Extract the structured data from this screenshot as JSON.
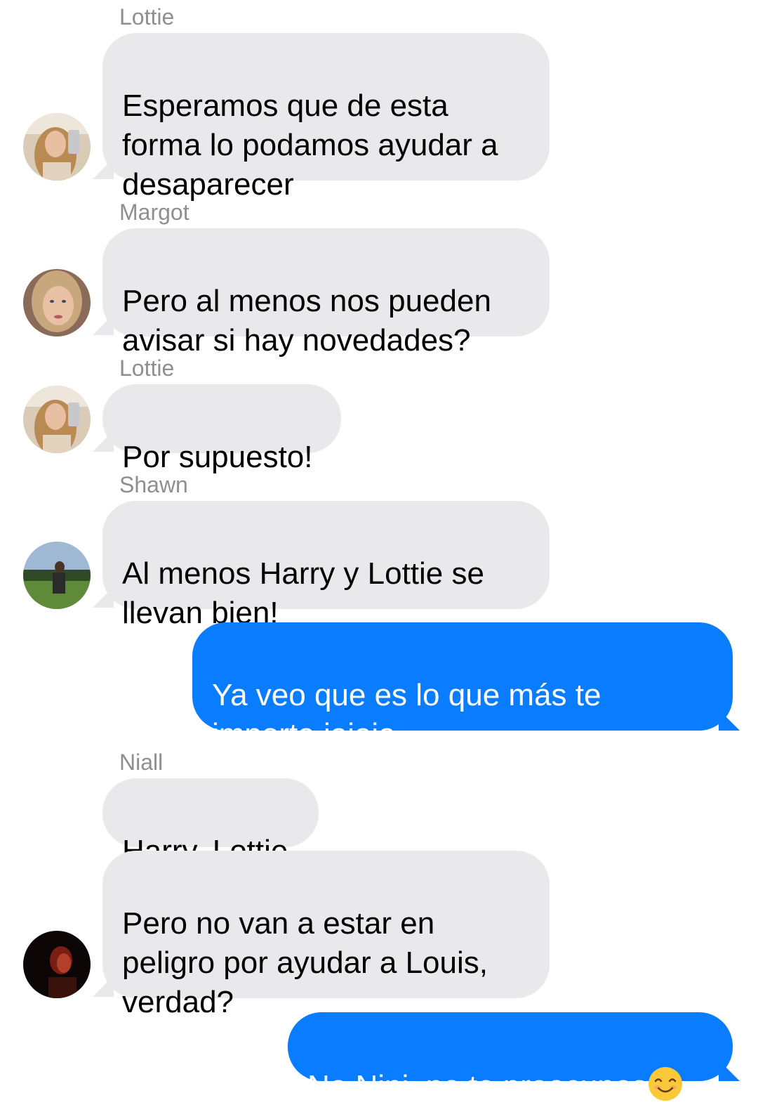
{
  "messages": [
    {
      "sender": "Lottie",
      "text": "Esperamos que de esta\nforma lo podamos ayudar  a\ndesaparecer"
    },
    {
      "sender": "Margot",
      "text": "Pero al menos nos pueden\navisar si hay novedades?"
    },
    {
      "sender": "Lottie",
      "text": "Por supuesto!"
    },
    {
      "sender": "Shawn",
      "text": "Al menos Harry y Lottie se\nllevan bien!"
    },
    {
      "sender": "",
      "text": "Ya veo que es lo que más te\nimporta jajaja"
    },
    {
      "sender": "Niall",
      "text": "Harry, Lottie"
    },
    {
      "sender": "",
      "text": "Pero no van a estar en\npeligro por ayudar a Louis,\nverdad?"
    },
    {
      "sender": "",
      "text": "No Nini, no te preocupes"
    }
  ],
  "emoji": "smiling-face-emoji",
  "colors": {
    "incoming_bubble": "#e9e9eb",
    "outgoing_bubble": "#0a7cff",
    "sender_label": "#8e8e93"
  }
}
